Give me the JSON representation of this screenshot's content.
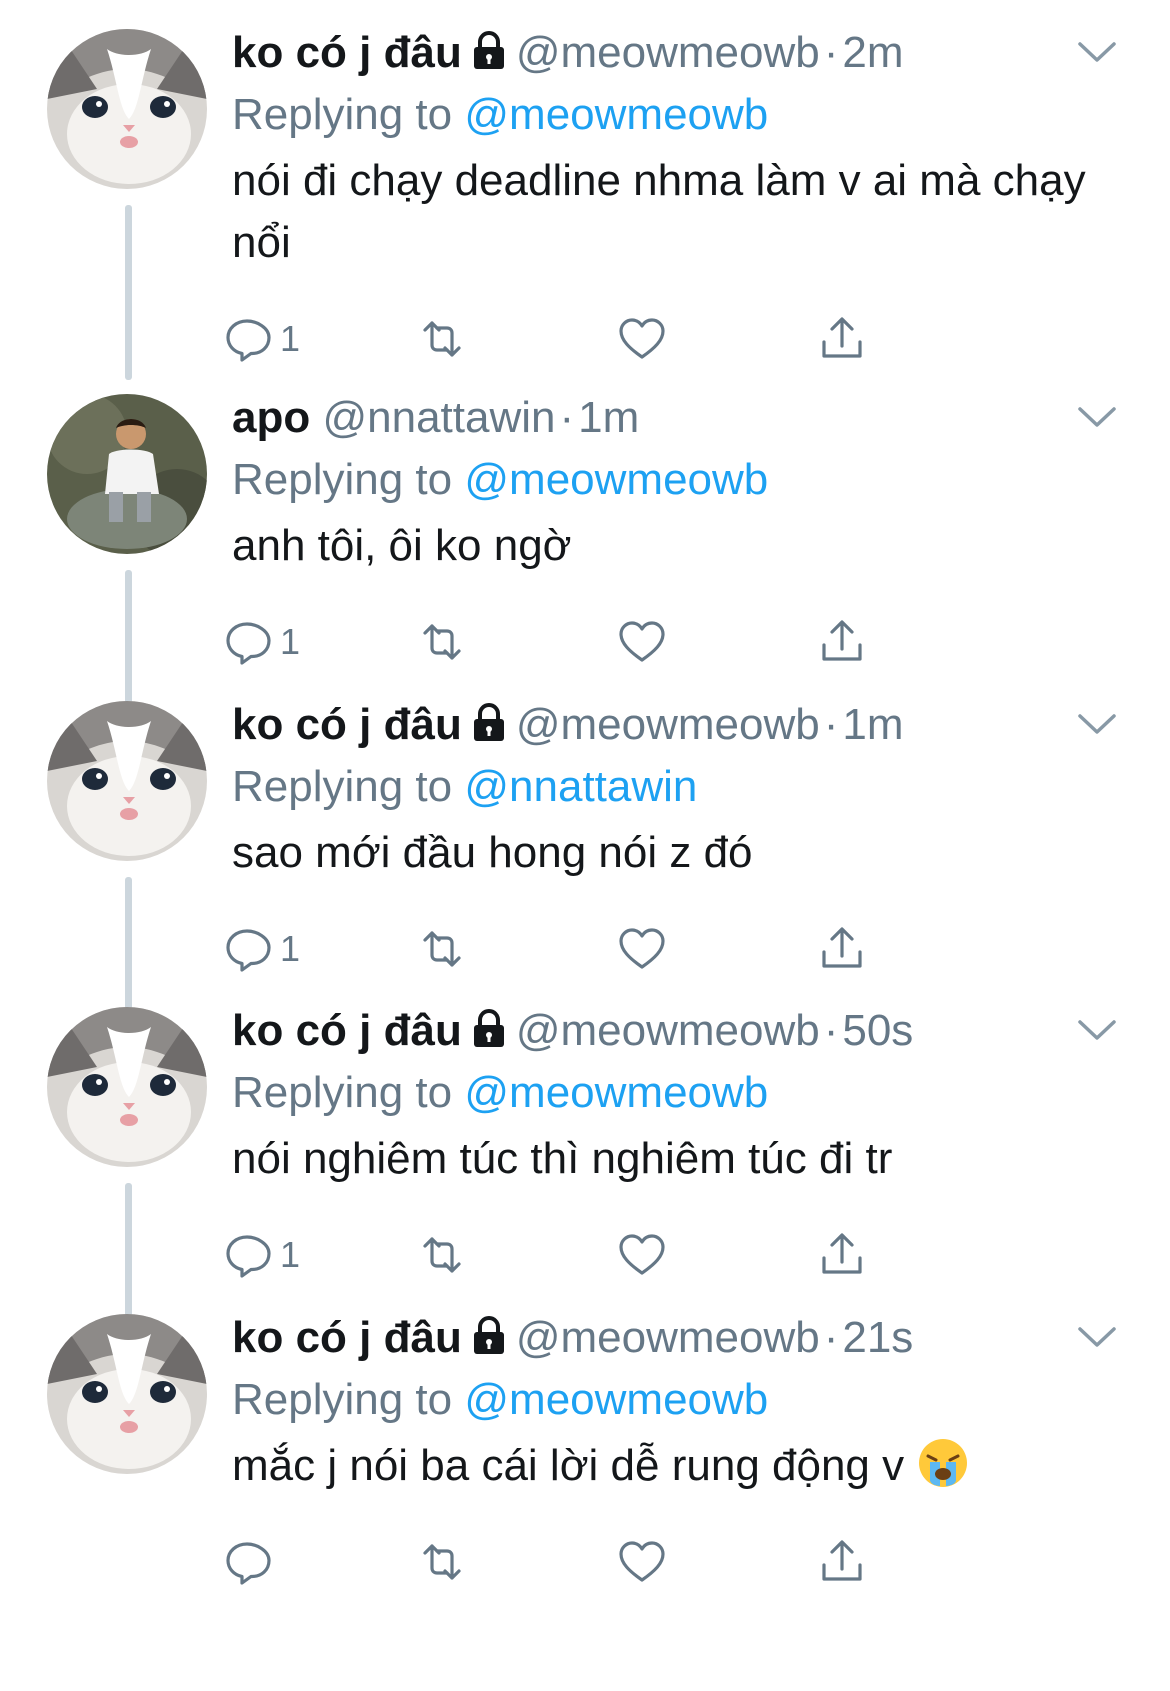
{
  "tweets": [
    {
      "name": "ko có j đâu",
      "locked": true,
      "handle": "@meowmeowb",
      "time": "2m",
      "replying_label": "Replying to",
      "replying_to": "@meowmeowb",
      "text": "nói đi chạy deadline nhma làm v ai mà chạy nổi",
      "reply_count": "1",
      "avatar": "kitten"
    },
    {
      "name": "apo",
      "locked": false,
      "handle": "@nnattawin",
      "time": "1m",
      "replying_label": "Replying to",
      "replying_to": "@meowmeowb",
      "text": "anh tôi, ôi ko ngờ",
      "reply_count": "1",
      "avatar": "person"
    },
    {
      "name": "ko có j đâu",
      "locked": true,
      "handle": "@meowmeowb",
      "time": "1m",
      "replying_label": "Replying to",
      "replying_to": "@nnattawin",
      "text": "sao mới đầu hong nói z đó",
      "reply_count": "1",
      "avatar": "kitten"
    },
    {
      "name": "ko có j đâu",
      "locked": true,
      "handle": "@meowmeowb",
      "time": "50s",
      "replying_label": "Replying to",
      "replying_to": "@meowmeowb",
      "text": "nói nghiêm túc thì nghiêm túc đi tr",
      "reply_count": "1",
      "avatar": "kitten"
    },
    {
      "name": "ko có j đâu",
      "locked": true,
      "handle": "@meowmeowb",
      "time": "21s",
      "replying_label": "Replying to",
      "replying_to": "@meowmeowb",
      "text": "mắc j nói ba cái lời dễ rung động v",
      "reply_count": "",
      "avatar": "kitten",
      "emoji": "loudly-crying-face"
    }
  ],
  "icons": {
    "reply": "reply-icon",
    "retweet": "retweet-icon",
    "like": "heart-icon",
    "share": "share-icon",
    "more": "chevron-down-icon",
    "lock": "lock-icon"
  },
  "colors": {
    "link": "#1da1f2",
    "secondary": "#657786",
    "thread_line": "#ccd6dd"
  }
}
